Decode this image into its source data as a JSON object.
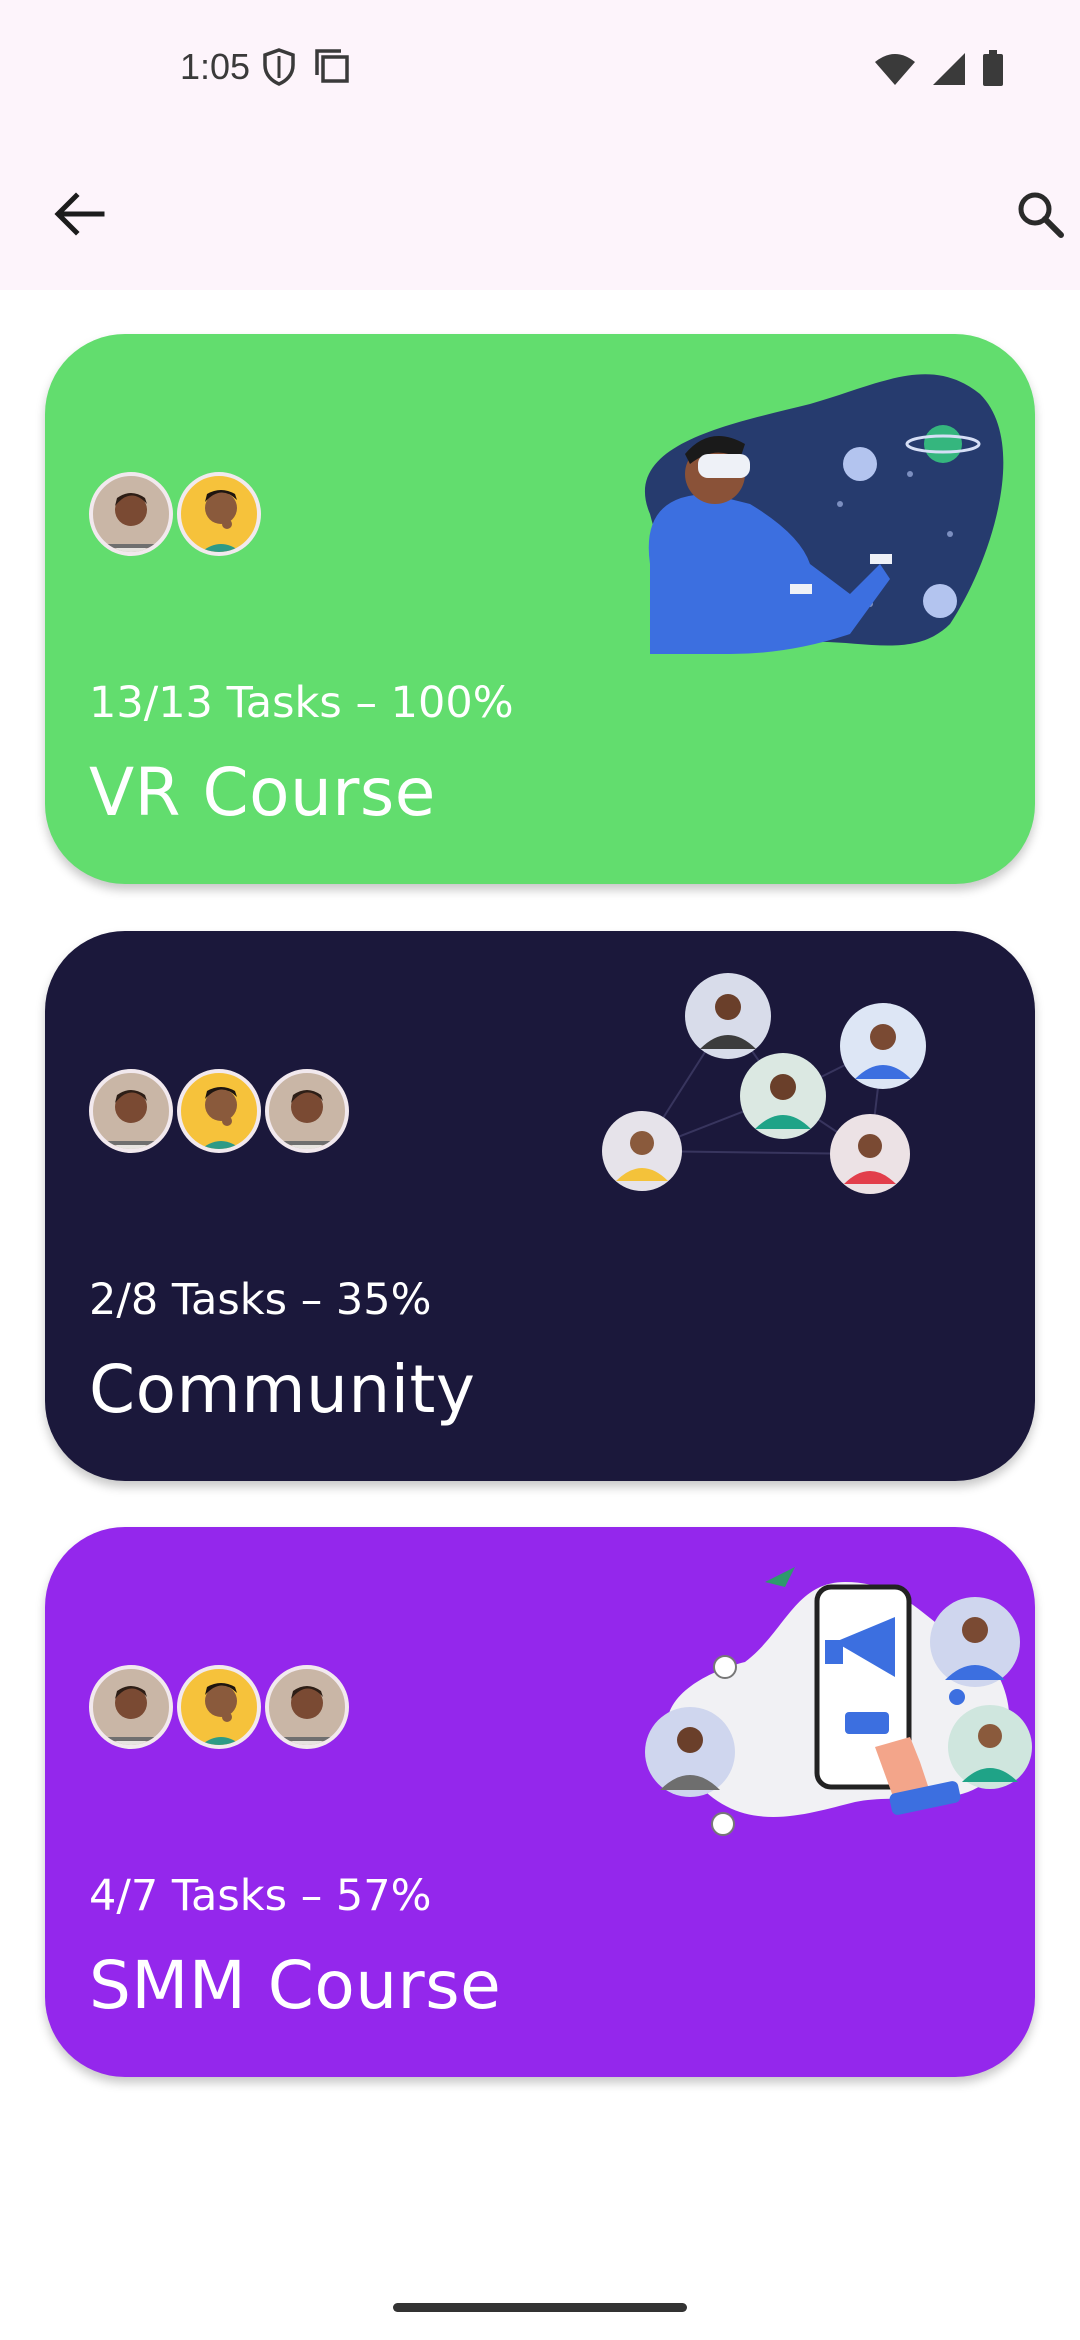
{
  "status_bar": {
    "time": "1:05",
    "icons": [
      "shield-icon",
      "screenshot-icon",
      "wifi-icon",
      "signal-icon",
      "battery-icon"
    ]
  },
  "app_bar": {
    "back_icon": "arrow-left-icon",
    "search_icon": "search-icon"
  },
  "cards": [
    {
      "progress": "13/13 Tasks – 100%",
      "title": "VR Course",
      "color": "#62dd6e",
      "avatars": [
        "person-1",
        "person-2"
      ],
      "illustration": "vr-headset-illustration"
    },
    {
      "progress": "2/8 Tasks – 35%",
      "title": "Community",
      "color": "#1b183b",
      "avatars": [
        "person-1",
        "person-2",
        "person-1"
      ],
      "illustration": "network-people-illustration"
    },
    {
      "progress": "4/7 Tasks – 57%",
      "title": "SMM Course",
      "color": "#9427ec",
      "avatars": [
        "person-1",
        "person-2",
        "person-1"
      ],
      "illustration": "marketing-phone-illustration"
    }
  ]
}
